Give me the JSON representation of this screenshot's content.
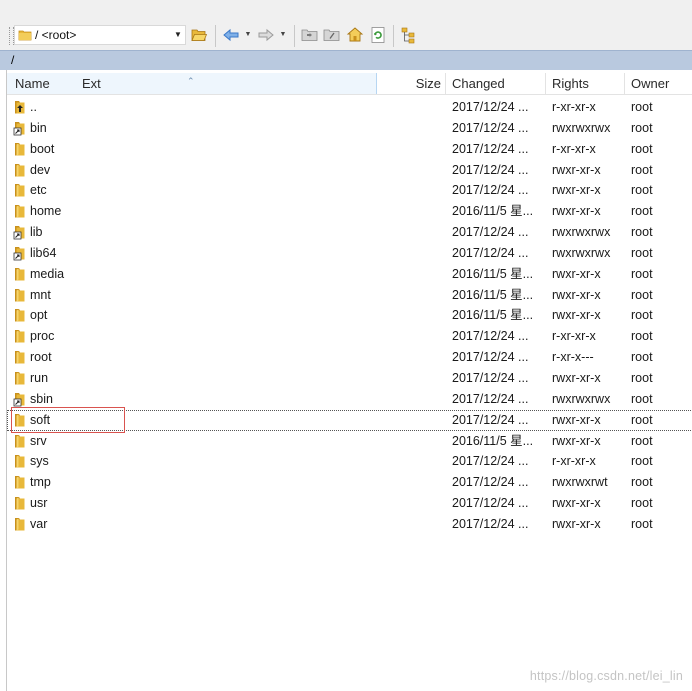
{
  "toolbar": {
    "path_value": "/ <root>",
    "icons": [
      "open-folder-icon",
      "back-arrow-icon",
      "forward-arrow-icon",
      "parent-dir-icon",
      "root-dir-icon",
      "home-icon",
      "refresh-icon",
      "tree-icon"
    ]
  },
  "location": {
    "path": "/"
  },
  "columns": {
    "name": "Name",
    "ext": "Ext",
    "size": "Size",
    "changed": "Changed",
    "rights": "Rights",
    "owner": "Owner"
  },
  "rows": [
    {
      "name": "..",
      "changed": "2017/12/24 ...",
      "rights": "r-xr-xr-x",
      "owner": "root",
      "icon": "parent"
    },
    {
      "name": "bin",
      "changed": "2017/12/24 ...",
      "rights": "rwxrwxrwx",
      "owner": "root",
      "icon": "link"
    },
    {
      "name": "boot",
      "changed": "2017/12/24 ...",
      "rights": "r-xr-xr-x",
      "owner": "root",
      "icon": "folder"
    },
    {
      "name": "dev",
      "changed": "2017/12/24 ...",
      "rights": "rwxr-xr-x",
      "owner": "root",
      "icon": "folder"
    },
    {
      "name": "etc",
      "changed": "2017/12/24 ...",
      "rights": "rwxr-xr-x",
      "owner": "root",
      "icon": "folder"
    },
    {
      "name": "home",
      "changed": "2016/11/5 星...",
      "rights": "rwxr-xr-x",
      "owner": "root",
      "icon": "folder"
    },
    {
      "name": "lib",
      "changed": "2017/12/24 ...",
      "rights": "rwxrwxrwx",
      "owner": "root",
      "icon": "link"
    },
    {
      "name": "lib64",
      "changed": "2017/12/24 ...",
      "rights": "rwxrwxrwx",
      "owner": "root",
      "icon": "link"
    },
    {
      "name": "media",
      "changed": "2016/11/5 星...",
      "rights": "rwxr-xr-x",
      "owner": "root",
      "icon": "folder"
    },
    {
      "name": "mnt",
      "changed": "2016/11/5 星...",
      "rights": "rwxr-xr-x",
      "owner": "root",
      "icon": "folder"
    },
    {
      "name": "opt",
      "changed": "2016/11/5 星...",
      "rights": "rwxr-xr-x",
      "owner": "root",
      "icon": "folder"
    },
    {
      "name": "proc",
      "changed": "2017/12/24 ...",
      "rights": "r-xr-xr-x",
      "owner": "root",
      "icon": "folder"
    },
    {
      "name": "root",
      "changed": "2017/12/24 ...",
      "rights": "r-xr-x---",
      "owner": "root",
      "icon": "folder"
    },
    {
      "name": "run",
      "changed": "2017/12/24 ...",
      "rights": "rwxr-xr-x",
      "owner": "root",
      "icon": "folder"
    },
    {
      "name": "sbin",
      "changed": "2017/12/24 ...",
      "rights": "rwxrwxrwx",
      "owner": "root",
      "icon": "link"
    },
    {
      "name": "soft",
      "changed": "2017/12/24 ...",
      "rights": "rwxr-xr-x",
      "owner": "root",
      "icon": "folder",
      "focused": true
    },
    {
      "name": "srv",
      "changed": "2016/11/5 星...",
      "rights": "rwxr-xr-x",
      "owner": "root",
      "icon": "folder"
    },
    {
      "name": "sys",
      "changed": "2017/12/24 ...",
      "rights": "r-xr-xr-x",
      "owner": "root",
      "icon": "folder"
    },
    {
      "name": "tmp",
      "changed": "2017/12/24 ...",
      "rights": "rwxrwxrwt",
      "owner": "root",
      "icon": "folder"
    },
    {
      "name": "usr",
      "changed": "2017/12/24 ...",
      "rights": "rwxr-xr-x",
      "owner": "root",
      "icon": "folder"
    },
    {
      "name": "var",
      "changed": "2017/12/24 ...",
      "rights": "rwxr-xr-x",
      "owner": "root",
      "icon": "folder"
    }
  ],
  "watermark": "https://blog.csdn.net/lei_lin",
  "colors": {
    "folder": "#e8b83a",
    "folder_dark": "#c8901c",
    "location_bar": "#b9c9df",
    "highlight_box": "#d9534f",
    "arrow_blue": "#3a78c8"
  }
}
